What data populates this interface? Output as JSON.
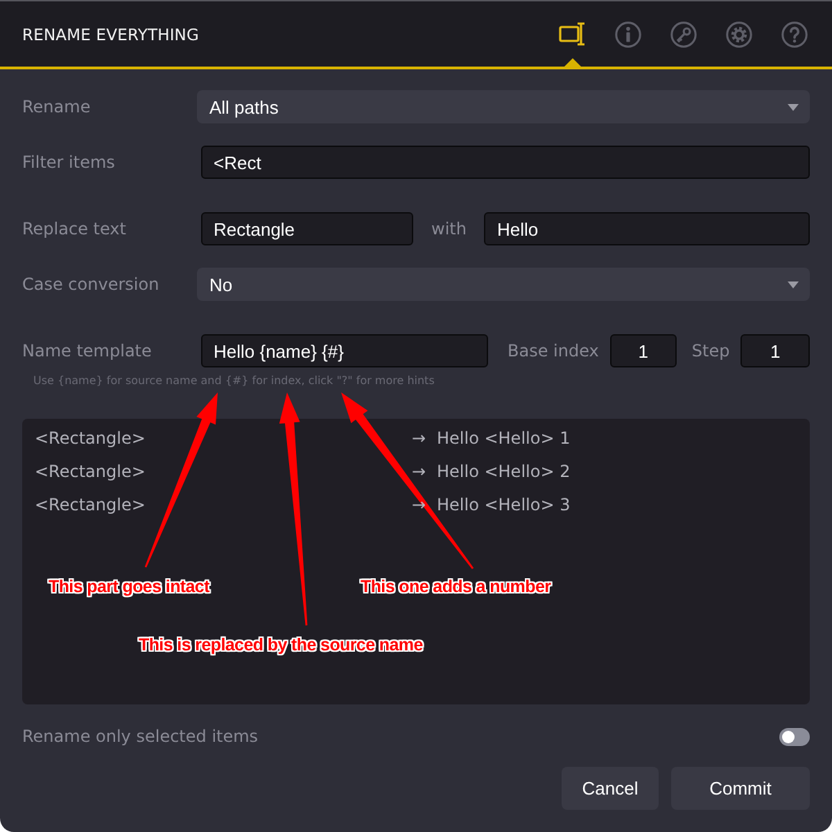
{
  "header": {
    "title": "RENAME EVERYTHING",
    "tabs": [
      {
        "kind": "rename",
        "selected": true
      },
      {
        "kind": "info",
        "selected": false
      },
      {
        "kind": "key",
        "selected": false
      },
      {
        "kind": "settings",
        "selected": false
      },
      {
        "kind": "help",
        "selected": false
      }
    ]
  },
  "groups": [
    [
      {
        "kind": "dropdown",
        "label": "Rename",
        "value": "All paths"
      },
      {
        "kind": "text",
        "label": "Filter items",
        "value": "<Rect"
      }
    ],
    [
      {
        "kind": "replace",
        "label": "Replace text",
        "value": "Rectangle",
        "with_label": "with",
        "with_value": "Hello"
      },
      {
        "kind": "dropdown",
        "label": "Case conversion",
        "value": "No"
      }
    ],
    [
      {
        "kind": "template",
        "label": "Name template",
        "value": "Hello {name} {#}",
        "base_index_label": "Base index",
        "base_index": "1",
        "step_label": "Step",
        "step": "1"
      }
    ]
  ],
  "hint": "Use {name} for source name and {#} for index, click \"?\" for more hints",
  "preview": [
    {
      "source": "<Rectangle>",
      "arrow": "→",
      "result": "Hello <Hello> 1"
    },
    {
      "source": "<Rectangle>",
      "arrow": "→",
      "result": "Hello <Hello> 2"
    },
    {
      "source": "<Rectangle>",
      "arrow": "→",
      "result": "Hello <Hello> 3"
    }
  ],
  "callouts": [
    {
      "text": "This part goes intact"
    },
    {
      "text": "This one adds a number"
    },
    {
      "text": "This is replaced by the source name"
    }
  ],
  "toggle": {
    "label": "Rename only selected items",
    "on": false
  },
  "buttons": [
    "Cancel",
    "Commit"
  ]
}
